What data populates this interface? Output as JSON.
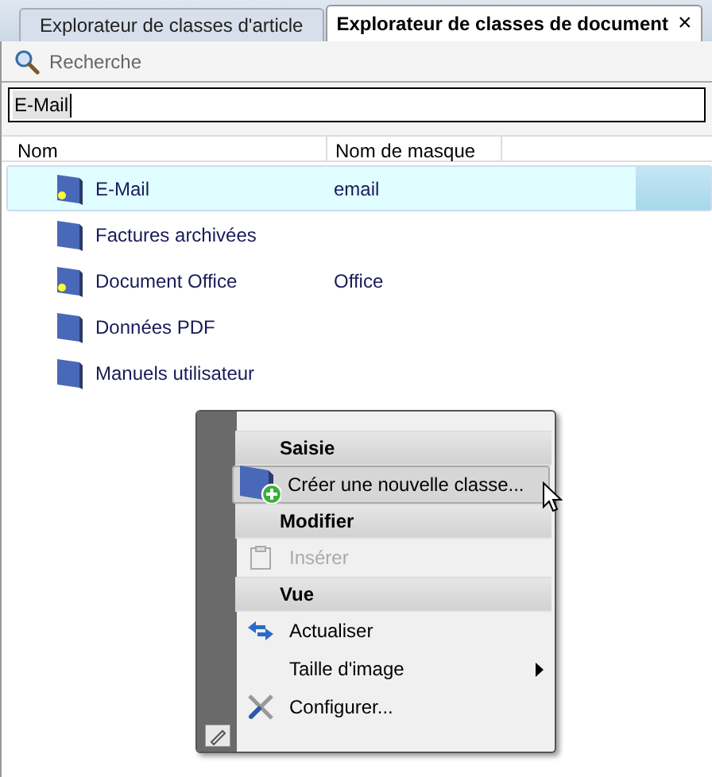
{
  "tabs": [
    {
      "label": "Explorateur de classes d'article",
      "selected": false
    },
    {
      "label": "Explorateur de classes de document",
      "selected": true,
      "close": "×"
    }
  ],
  "search": {
    "label": "Recherche"
  },
  "filter_field": {
    "value": "E-Mail"
  },
  "columns": [
    "Nom",
    "Nom de masque"
  ],
  "rows": [
    {
      "name": "E-Mail",
      "mask": "email",
      "dot": true,
      "selected": true
    },
    {
      "name": "Factures archivées",
      "dot": false,
      "selected": false
    },
    {
      "name": "Document Office",
      "mask": "Office",
      "dot": true,
      "selected": false
    },
    {
      "name": "Données PDF",
      "dot": false,
      "selected": false
    },
    {
      "name": "Manuels utilisateur",
      "dot": false,
      "selected": false
    }
  ],
  "context_menu": {
    "items": [
      {
        "kind": "header",
        "label": "Saisie"
      },
      {
        "kind": "item",
        "label": "Créer une nouvelle classe...",
        "selected": true,
        "disabled": false
      },
      {
        "kind": "header",
        "label": "Modifier"
      },
      {
        "kind": "item",
        "label": "Insérer",
        "selected": false,
        "disabled": true
      },
      {
        "kind": "header",
        "label": "Vue"
      },
      {
        "kind": "item",
        "label": "Actualiser",
        "selected": false,
        "disabled": false
      },
      {
        "kind": "item",
        "label": "Taille d'image",
        "selected": false,
        "disabled": false,
        "submenu": true
      },
      {
        "kind": "item",
        "label": "Configurer...",
        "selected": false,
        "disabled": false
      }
    ]
  }
}
